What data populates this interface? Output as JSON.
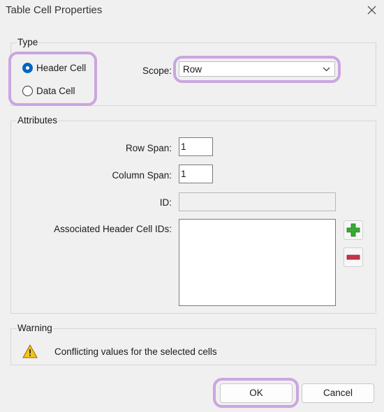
{
  "window": {
    "title": "Table Cell Properties",
    "close_icon": "close-icon"
  },
  "type_group": {
    "label": "Type",
    "options": [
      {
        "label": "Header Cell",
        "selected": true
      },
      {
        "label": "Data Cell",
        "selected": false
      }
    ],
    "scope_label": "Scope:",
    "scope_value": "Row"
  },
  "attributes_group": {
    "label": "Attributes",
    "row_span_label": "Row Span:",
    "row_span_value": "1",
    "column_span_label": "Column Span:",
    "column_span_value": "1",
    "id_label": "ID:",
    "id_value": "",
    "associated_label": "Associated Header Cell IDs:",
    "add_icon": "plus-icon",
    "remove_icon": "minus-icon"
  },
  "warning_group": {
    "label": "Warning",
    "icon": "warning-icon",
    "message": "Conflicting values for the selected cells"
  },
  "buttons": {
    "ok": "OK",
    "cancel": "Cancel"
  },
  "colors": {
    "highlight": "#caa6e0",
    "radio_selected": "#0067c0",
    "plus_green": "#3aa935",
    "minus_red": "#c8344b",
    "warning_yellow": "#f5c518"
  }
}
